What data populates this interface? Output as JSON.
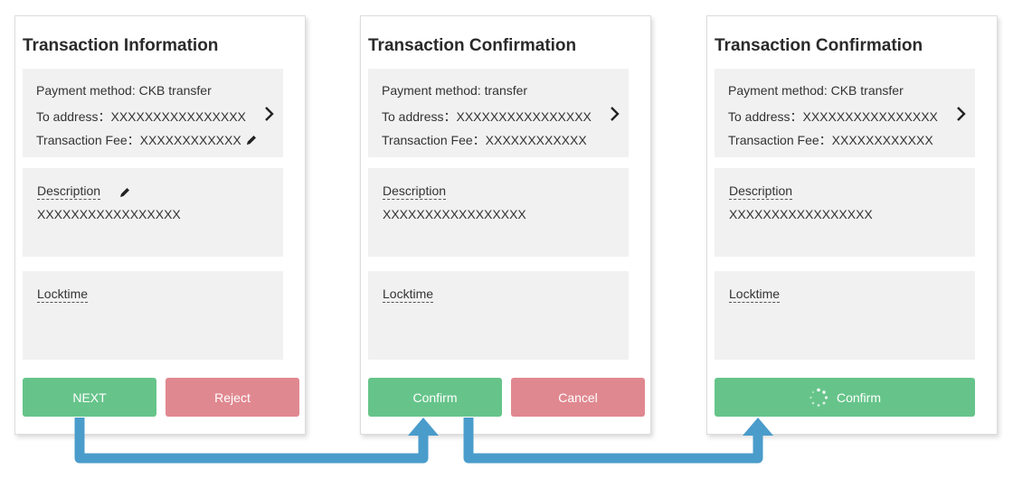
{
  "panels": [
    {
      "title": "Transaction Information",
      "payment_method": "Payment method: CKB transfer",
      "to_address": "To address：XXXXXXXXXXXXXXXX",
      "fee": "Transaction Fee：XXXXXXXXXXXX",
      "description_label": "Description",
      "description_value": "XXXXXXXXXXXXXXXXX",
      "locktime_label": "Locktime",
      "button_primary": "NEXT",
      "button_secondary": "Reject"
    },
    {
      "title": "Transaction Confirmation",
      "payment_method": "Payment method: transfer",
      "to_address": "To address：XXXXXXXXXXXXXXXX",
      "fee": "Transaction Fee：XXXXXXXXXXXX",
      "description_label": "Description",
      "description_value": "XXXXXXXXXXXXXXXXX",
      "locktime_label": "Locktime",
      "button_primary": "Confirm",
      "button_secondary": "Cancel"
    },
    {
      "title": "Transaction Confirmation",
      "payment_method": "Payment method: CKB transfer",
      "to_address": "To address：XXXXXXXXXXXXXXXX",
      "fee": "Transaction Fee：XXXXXXXXXXXX",
      "description_label": "Description",
      "description_value": "XXXXXXXXXXXXXXXXX",
      "locktime_label": "Locktime",
      "button_primary": "Confirm"
    }
  ],
  "colors": {
    "confirm_green": "#66c48a",
    "reject_red": "#e08890",
    "flow_arrow_blue": "#4a9ccb",
    "box_gray": "#f1f1f1"
  },
  "icons": [
    "chevron-right-icon",
    "pencil-icon",
    "loading-spinner-icon",
    "flow-arrow"
  ]
}
